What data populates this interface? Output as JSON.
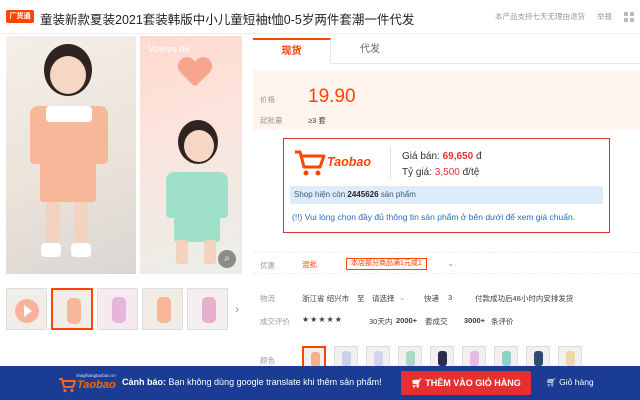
{
  "header": {
    "shop_tag": "厂货通",
    "title": "童装新款夏装2021套装韩版中小儿童短袖t恤0-5岁两件套潮一件代发",
    "support_text": "本产品支持七天无理由退货",
    "report_label": "举报"
  },
  "gallery": {
    "side_photo_text": "Volevo de",
    "zoom_icon": "magnifier-icon",
    "thumbs": [
      "video",
      "img1",
      "img2",
      "img3",
      "img4"
    ]
  },
  "tabs": [
    {
      "label": "现货"
    },
    {
      "label": "代发"
    }
  ],
  "price": {
    "price_label": "价格",
    "price_value": "19.90",
    "min_batch_label": "起批量",
    "min_batch_value": "≥3 套"
  },
  "taobao_box": {
    "logo_text": "Taobao",
    "price_label": "Giá bán:",
    "price_vnd": "69,650",
    "price_unit": "đ",
    "rate_label": "Tỷ giá:",
    "rate_value": "3,500",
    "rate_unit": "đ/tệ",
    "stock_prefix": "Shop hiện còn",
    "stock_count": "2445626",
    "stock_suffix": "sản phẩm",
    "notice": "(!!) Vui lòng chọn đầy đủ thông tin sản phẩm ở bên dưới để xem giá chuẩn."
  },
  "promo": {
    "label": "优惠",
    "tag": "混批",
    "coupon": "本店部分商品满1元或1",
    "chevron": "chevron-down-icon"
  },
  "shipping": {
    "label": "物流",
    "origin": "浙江省 绍兴市",
    "to": "至",
    "dest": "请选择",
    "express": "快递",
    "fee": "3",
    "note": "付款成功后48小时内安排发货"
  },
  "reviews": {
    "label": "成交评价",
    "stars": "★★★★★",
    "days": "30天内",
    "deals": "2000+",
    "deals_suffix": "套成交",
    "reviews": "3000+",
    "reviews_suffix": "条评价"
  },
  "colors": {
    "label": "颜色",
    "swatches": [
      {
        "color": "#f5b08f",
        "selected": true
      },
      {
        "color": "#c9d3e6",
        "selected": false
      },
      {
        "color": "#cfd6e7",
        "selected": false
      },
      {
        "color": "#a7dcc3",
        "selected": false
      },
      {
        "color": "#2b2b4a",
        "selected": false
      },
      {
        "color": "#e9b9e2",
        "selected": false
      },
      {
        "color": "#8fd1c5",
        "selected": false
      },
      {
        "color": "#2e4b77",
        "selected": false
      },
      {
        "color": "#efd6a8",
        "selected": false
      }
    ]
  },
  "bottom_bar": {
    "logo_small": "nhaphangtaobao.vn",
    "logo_text": "Taobao",
    "warning_prefix": "Cảnh báo:",
    "warning_text": "Bạn không dùng google translate khi thêm sản phẩm!",
    "add_to_cart": "THÊM VÀO GIỎ HÀNG",
    "cart_link": "Giỏ hàng"
  },
  "theme": {
    "accent": "#ff4400",
    "bar": "#1b3c94",
    "button": "#e62f2f"
  }
}
